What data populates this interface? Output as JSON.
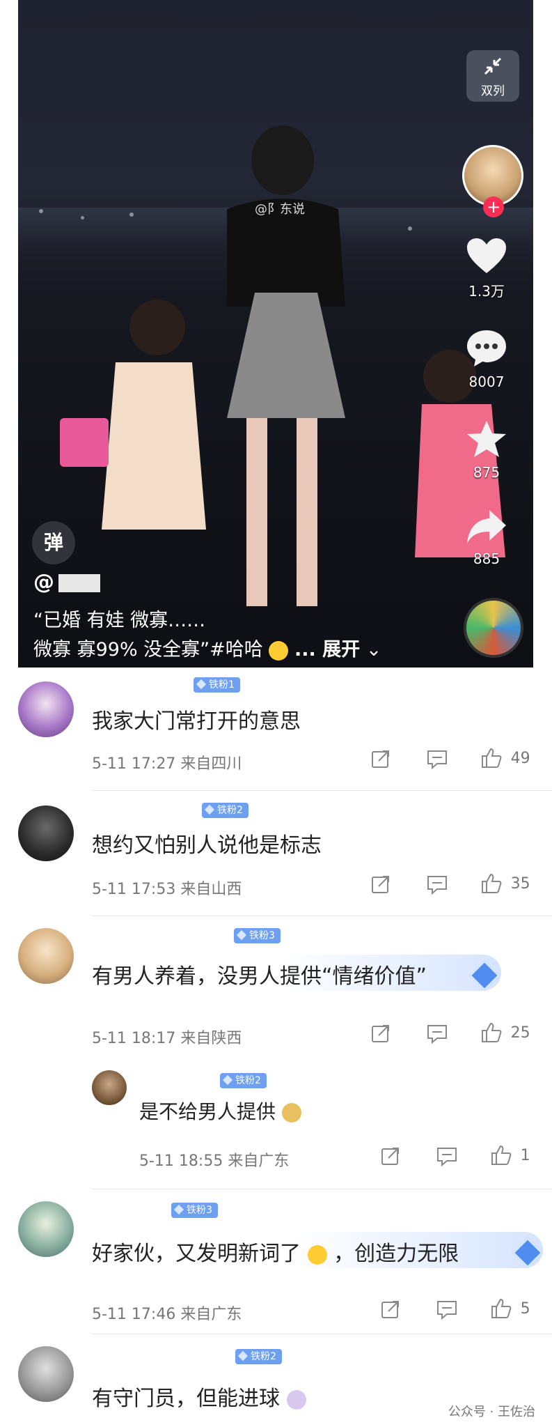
{
  "video": {
    "dual_label": "双列",
    "watermark": "@阝东说",
    "likes": "1.3万",
    "comments": "8007",
    "favorites": "875",
    "shares": "885",
    "danmu": "弹",
    "author": "@",
    "caption_line1": "“已婚  有娃  微寡……",
    "caption_line2": "微寡   寡99%    没全寡”#哈哈",
    "caption_more": "... 展开",
    "icons": [
      "compress-icon",
      "heart-icon",
      "comment-bubble-icon",
      "star-icon",
      "share-arrow-icon",
      "music-disc-icon"
    ]
  },
  "comments": [
    {
      "badge": "铁粉1",
      "text": "我家大门常打开的意思",
      "time": "5-11 17:27 来自四川",
      "likes": "49"
    },
    {
      "badge": "铁粉2",
      "text": "想约又怕别人说他是标志",
      "time": "5-11 17:53 来自山西",
      "likes": "35"
    },
    {
      "badge": "铁粉3",
      "text": "有男人养着，没男人提供“情绪价值”",
      "time": "5-11 18:17 来自陕西",
      "likes": "25"
    },
    {
      "badge": "铁粉2",
      "text": "是不给男人提供",
      "time": "5-11 18:55 来自广东",
      "likes": "1",
      "reply": true
    },
    {
      "badge": "铁粉3",
      "text_a": "好家伙，又发明新词了",
      "text_b": "，创造力无限",
      "time": "5-11 17:46 来自广东",
      "likes": "5"
    },
    {
      "badge": "铁粉2",
      "text": "有守门员，但能进球"
    }
  ],
  "footer": {
    "watermark": "公众号 · 王佐治"
  },
  "colors": {
    "badge": "#6f9ff0",
    "like_red": "#ff2d55"
  }
}
